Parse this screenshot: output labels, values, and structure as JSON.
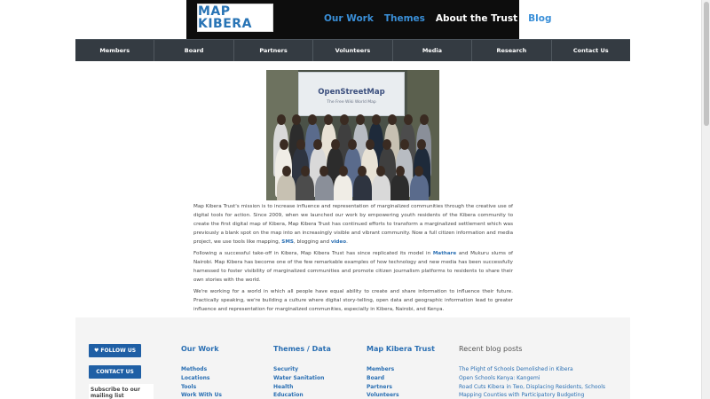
{
  "header": {
    "logo_text": "MAP KIBERA",
    "topnav": [
      {
        "label": "Our Work",
        "active": false
      },
      {
        "label": "Themes",
        "active": false
      },
      {
        "label": "About the Trust",
        "active": true
      },
      {
        "label": "Blog",
        "active": false
      }
    ]
  },
  "mainnav": [
    "Members",
    "Board",
    "Partners",
    "Volunteers",
    "Media",
    "Research",
    "Contact Us"
  ],
  "photo": {
    "banner_title": "OpenStreetMap",
    "banner_subtitle": "The Free Wiki World Map"
  },
  "content": {
    "p1": {
      "text": "Map Kibera Trust's mission is to increase influence and representation of marginalized communities through the creative use of digital tools for action. Since 2009, when we launched our work by empowering youth residents of the Kibera community to create the first digital map of Kibera, Map Kibera Trust has continued efforts to transform a marginalized settlement which was previously a blank spot on the map into an increasingly visible and vibrant community. Now a full citizen information and media project, we use tools like mapping,",
      "link1": "SMS",
      "mid": ", blogging and",
      "link2": "video",
      "end": "."
    },
    "p2": {
      "before": "Following a successful take-off in Kibera, Map Kibera Trust has since replicated its model in",
      "link": "Mathare",
      "after": "and Mukuru slums of Nairobi. Map Kibera has become one of the few remarkable examples of how technology and new media has been successfully harnessed to foster visibility of marginalized communities and promote citizen journalism platforms to residents to share their own stories with the world."
    },
    "p3": "We're working for a world in which all people have equal ability to create and share information to influence their future. Practically speaking, we're building a culture where digital story-telling, open data and geographic information lead to greater influence and representation for marginalized communities, especially in Kibera, Nairobi, and Kenya."
  },
  "footer": {
    "follow_label": "♥ FOLLOW US",
    "contact_label": "CONTACT US",
    "subscribe_label": "Subscribe to our mailing list",
    "columns": [
      {
        "title": "Our Work",
        "items": [
          "Methods",
          "Locations",
          "Tools",
          "Work With Us"
        ]
      },
      {
        "title": "Themes / Data",
        "items": [
          "Security",
          "Water Sanitation",
          "Health",
          "Education"
        ]
      },
      {
        "title": "Map Kibera Trust",
        "items": [
          "Members",
          "Board",
          "Partners",
          "Volunteers"
        ]
      },
      {
        "title": "Recent blog posts",
        "items": [
          "The Plight of Schools Demolished in Kibera",
          "Open Schools Kenya: Kangemi",
          "Road Cuts Kibera in Two, Displacing Residents, Schools",
          "Mapping Counties with Participatory Budgeting"
        ]
      }
    ]
  },
  "colors": {
    "accent": "#2a6fb3",
    "nav_bg": "#343b42",
    "header_bg": "#0d0d0d",
    "button_bg": "#1f5fa5"
  }
}
